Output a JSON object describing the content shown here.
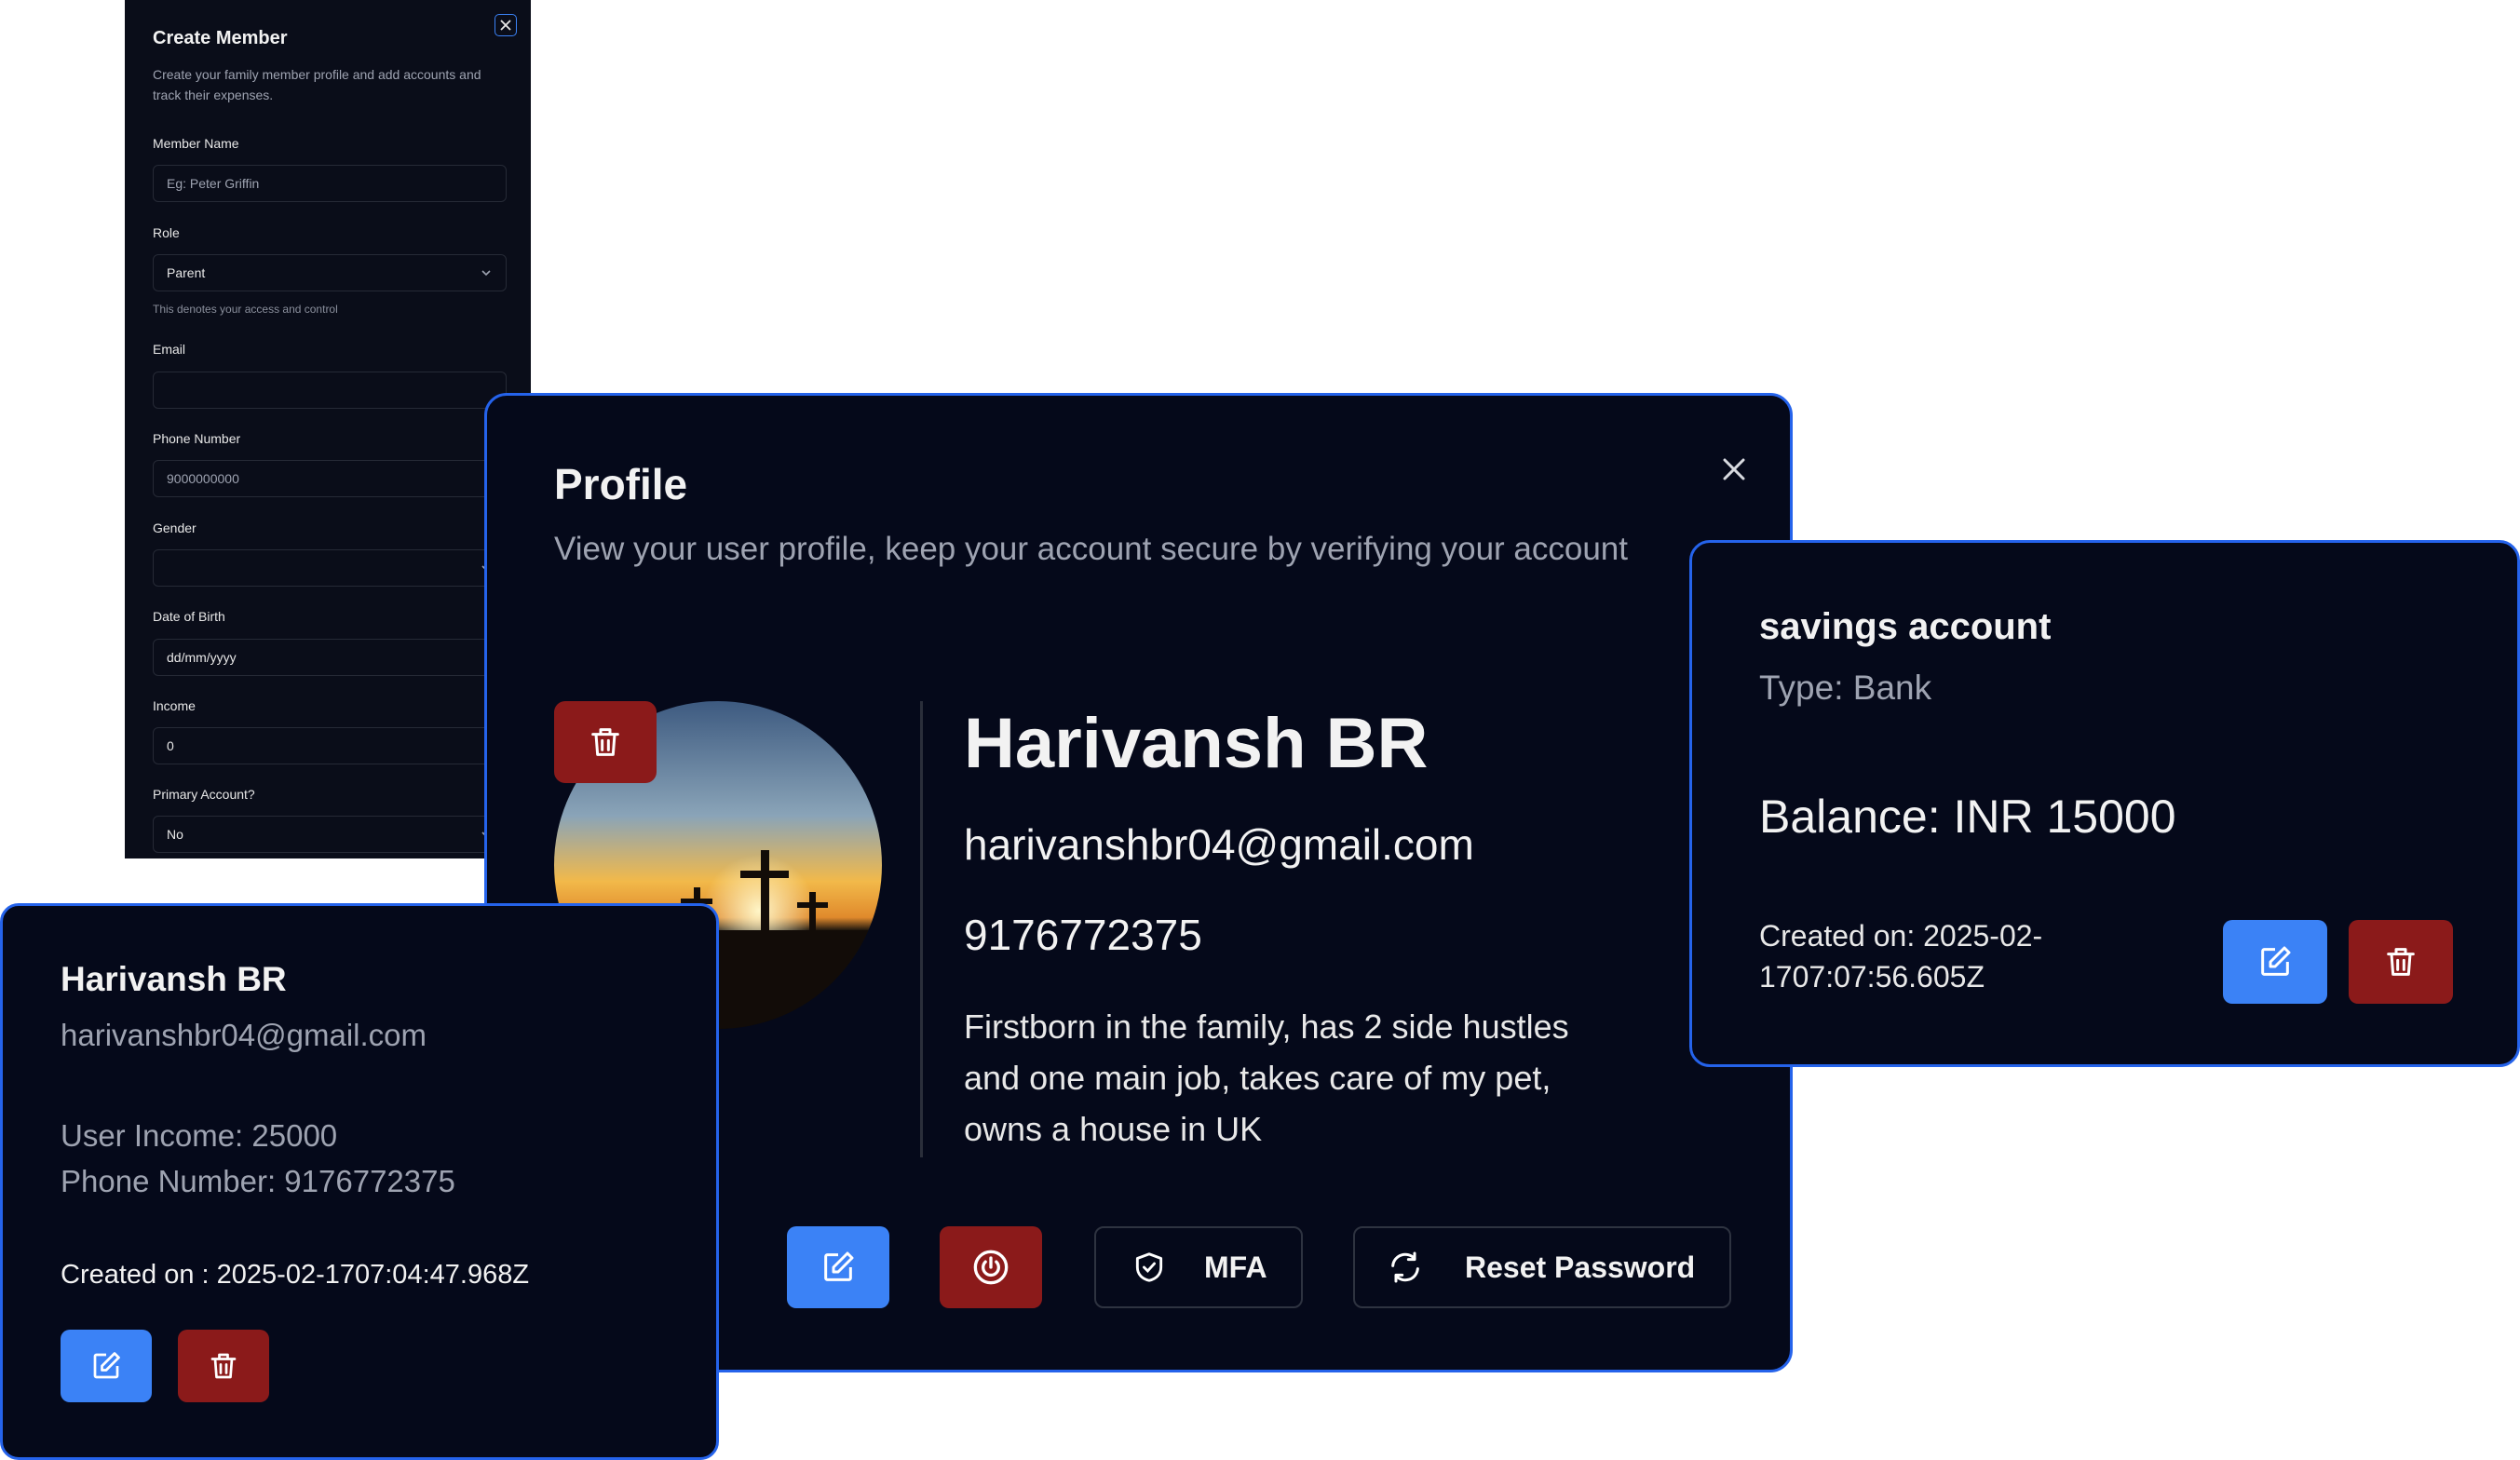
{
  "create_member": {
    "title": "Create Member",
    "description": "Create your family member profile and add accounts and track their expenses.",
    "fields": {
      "member_name": {
        "label": "Member Name",
        "placeholder": "Eg: Peter Griffin"
      },
      "role": {
        "label": "Role",
        "value": "Parent",
        "hint": "This denotes your access and control"
      },
      "email": {
        "label": "Email",
        "value": ""
      },
      "phone": {
        "label": "Phone Number",
        "placeholder": "9000000000"
      },
      "gender": {
        "label": "Gender",
        "value": ""
      },
      "dob": {
        "label": "Date of Birth",
        "value": "dd/mm/yyyy"
      },
      "income": {
        "label": "Income",
        "value": "0"
      },
      "primary_account": {
        "label": "Primary Account?",
        "value": "No"
      }
    }
  },
  "profile": {
    "title": "Profile",
    "description": "View your user profile, keep your account secure by verifying your account",
    "name": "Harivansh BR",
    "email": "harivanshbr04@gmail.com",
    "phone": "9176772375",
    "bio": "Firstborn in the family, has 2 side hustles and one main job, takes care of my pet, owns a house in UK",
    "actions": {
      "mfa_label": "MFA",
      "reset_label": "Reset Password"
    }
  },
  "member_card": {
    "name": "Harivansh BR",
    "email": "harivanshbr04@gmail.com",
    "income": "User Income: 25000",
    "phone": "Phone Number: 9176772375",
    "created": "Created on : 2025-02-1707:04:47.968Z"
  },
  "account_card": {
    "name": "savings account",
    "type": "Type: Bank",
    "balance": "Balance: INR 15000",
    "created": "Created on: 2025-02-1707:07:56.605Z"
  },
  "colors": {
    "accent": "#3b82f6",
    "danger": "#8b1a1a",
    "panel": "#05091a",
    "border": "#2563eb"
  },
  "icons": [
    "close-icon",
    "chevron-down-icon",
    "trash-icon",
    "edit-icon",
    "power-icon",
    "shield-check-icon",
    "refresh-icon"
  ]
}
